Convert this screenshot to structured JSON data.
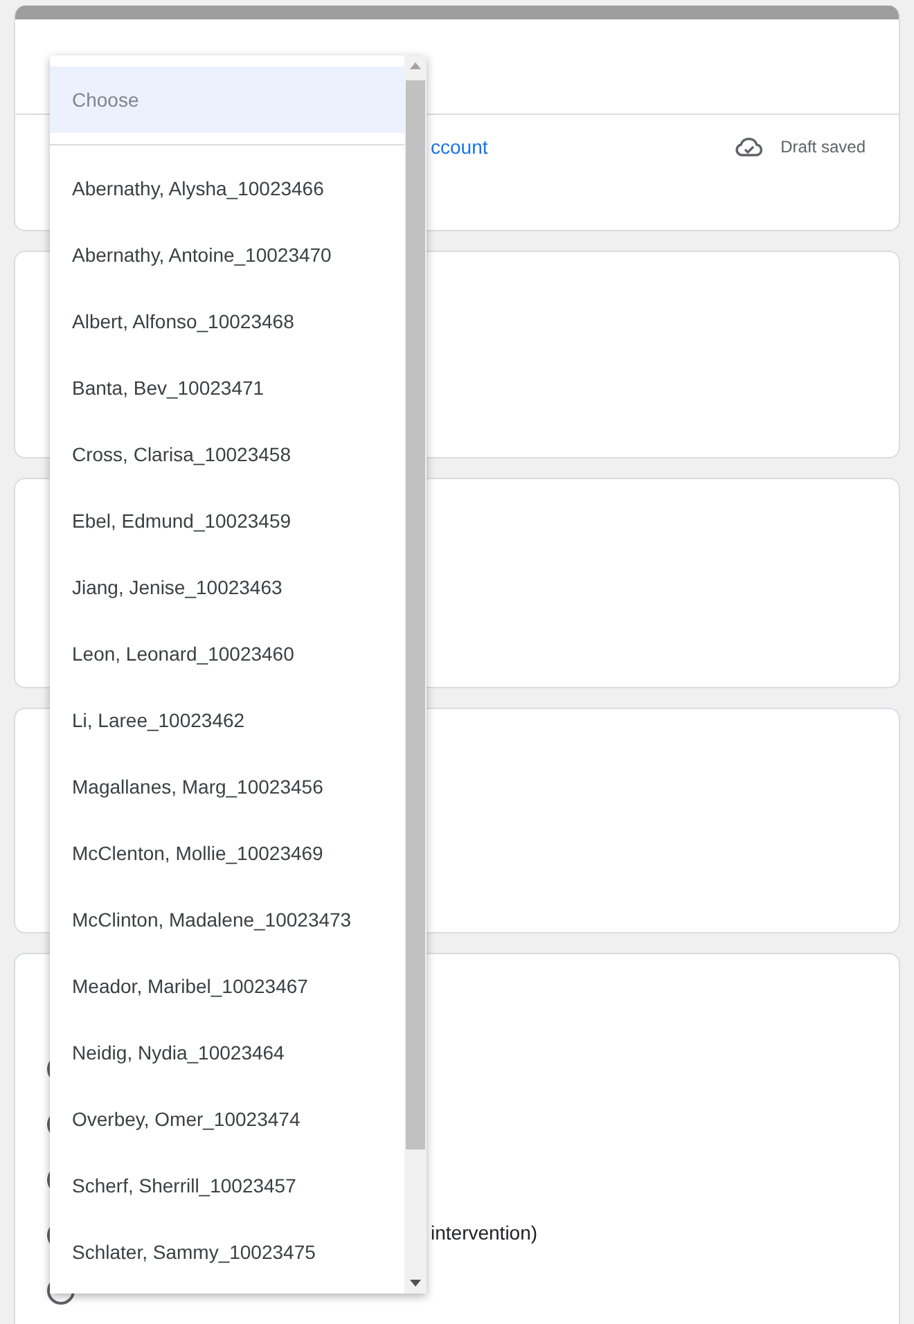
{
  "header": {
    "account_link": "ccount",
    "save_status": "Draft saved"
  },
  "question": {
    "option_text": "intervention)"
  },
  "dropdown": {
    "options": [
      {
        "label": "Choose",
        "kind": "placeholder",
        "selected": true
      },
      {
        "label": "Abernathy, Alysha_10023466",
        "kind": "option",
        "selected": false
      },
      {
        "label": "Abernathy, Antoine_10023470",
        "kind": "option",
        "selected": false
      },
      {
        "label": "Albert, Alfonso_10023468",
        "kind": "option",
        "selected": false
      },
      {
        "label": "Banta, Bev_10023471",
        "kind": "option",
        "selected": false
      },
      {
        "label": "Cross, Clarisa_10023458",
        "kind": "option",
        "selected": false
      },
      {
        "label": "Ebel, Edmund_10023459",
        "kind": "option",
        "selected": false
      },
      {
        "label": "Jiang, Jenise_10023463",
        "kind": "option",
        "selected": false
      },
      {
        "label": "Leon, Leonard_10023460",
        "kind": "option",
        "selected": false
      },
      {
        "label": "Li, Laree_10023462",
        "kind": "option",
        "selected": false
      },
      {
        "label": "Magallanes, Marg_10023456",
        "kind": "option",
        "selected": false
      },
      {
        "label": "McClenton, Mollie_10023469",
        "kind": "option",
        "selected": false
      },
      {
        "label": "McClinton, Madalene_10023473",
        "kind": "option",
        "selected": false
      },
      {
        "label": "Meador, Maribel_10023467",
        "kind": "option",
        "selected": false
      },
      {
        "label": "Neidig, Nydia_10023464",
        "kind": "option",
        "selected": false
      },
      {
        "label": "Overbey, Omer_10023474",
        "kind": "option",
        "selected": false
      },
      {
        "label": "Scherf, Sherrill_10023457",
        "kind": "option",
        "selected": false
      },
      {
        "label": "Schlater, Sammy_10023475",
        "kind": "option",
        "selected": false
      }
    ]
  }
}
